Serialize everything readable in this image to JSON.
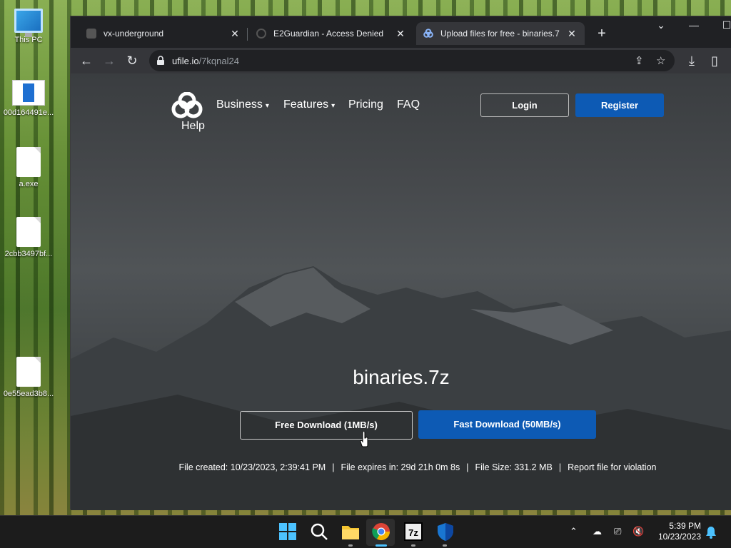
{
  "desktop": {
    "icons": [
      {
        "label": "This PC",
        "type": "pc"
      },
      {
        "label": "00d164491e...",
        "type": "doc"
      },
      {
        "label": "a.exe",
        "type": "file"
      },
      {
        "label": "2cbb3497bf...",
        "type": "file"
      },
      {
        "label": "0e55ead3b8...",
        "type": "file"
      }
    ]
  },
  "browser": {
    "tabs": [
      {
        "title": "vx-underground",
        "active": false
      },
      {
        "title": "E2Guardian - Access Denied",
        "active": false
      },
      {
        "title": "Upload files for free - binaries.7",
        "active": true
      }
    ],
    "new_tab": "+",
    "url_host": "ufile.io",
    "url_path": "/7kqnal24"
  },
  "site": {
    "nav": {
      "business": "Business",
      "features": "Features",
      "pricing": "Pricing",
      "faq": "FAQ",
      "help": "Help",
      "login": "Login",
      "register": "Register"
    },
    "file_name": "binaries.7z",
    "free_download": "Free Download (1MB/s)",
    "fast_download": "Fast Download (50MB/s)",
    "file_created": "File created: 10/23/2023, 2:39:41 PM",
    "file_expires": "File expires in: 29d 21h 0m 8s",
    "file_size": "File Size: 331.2 MB",
    "report": "Report file for violation",
    "separator": "|",
    "colors": {
      "accent": "#0d5ab4"
    }
  },
  "taskbar": {
    "time": "5:39 PM",
    "date": "10/23/2023",
    "apps": [
      "start-icon",
      "search-icon",
      "file-explorer-icon",
      "chrome-icon",
      "7zip-icon",
      "defender-icon"
    ],
    "sevenzip_label": "7z"
  }
}
